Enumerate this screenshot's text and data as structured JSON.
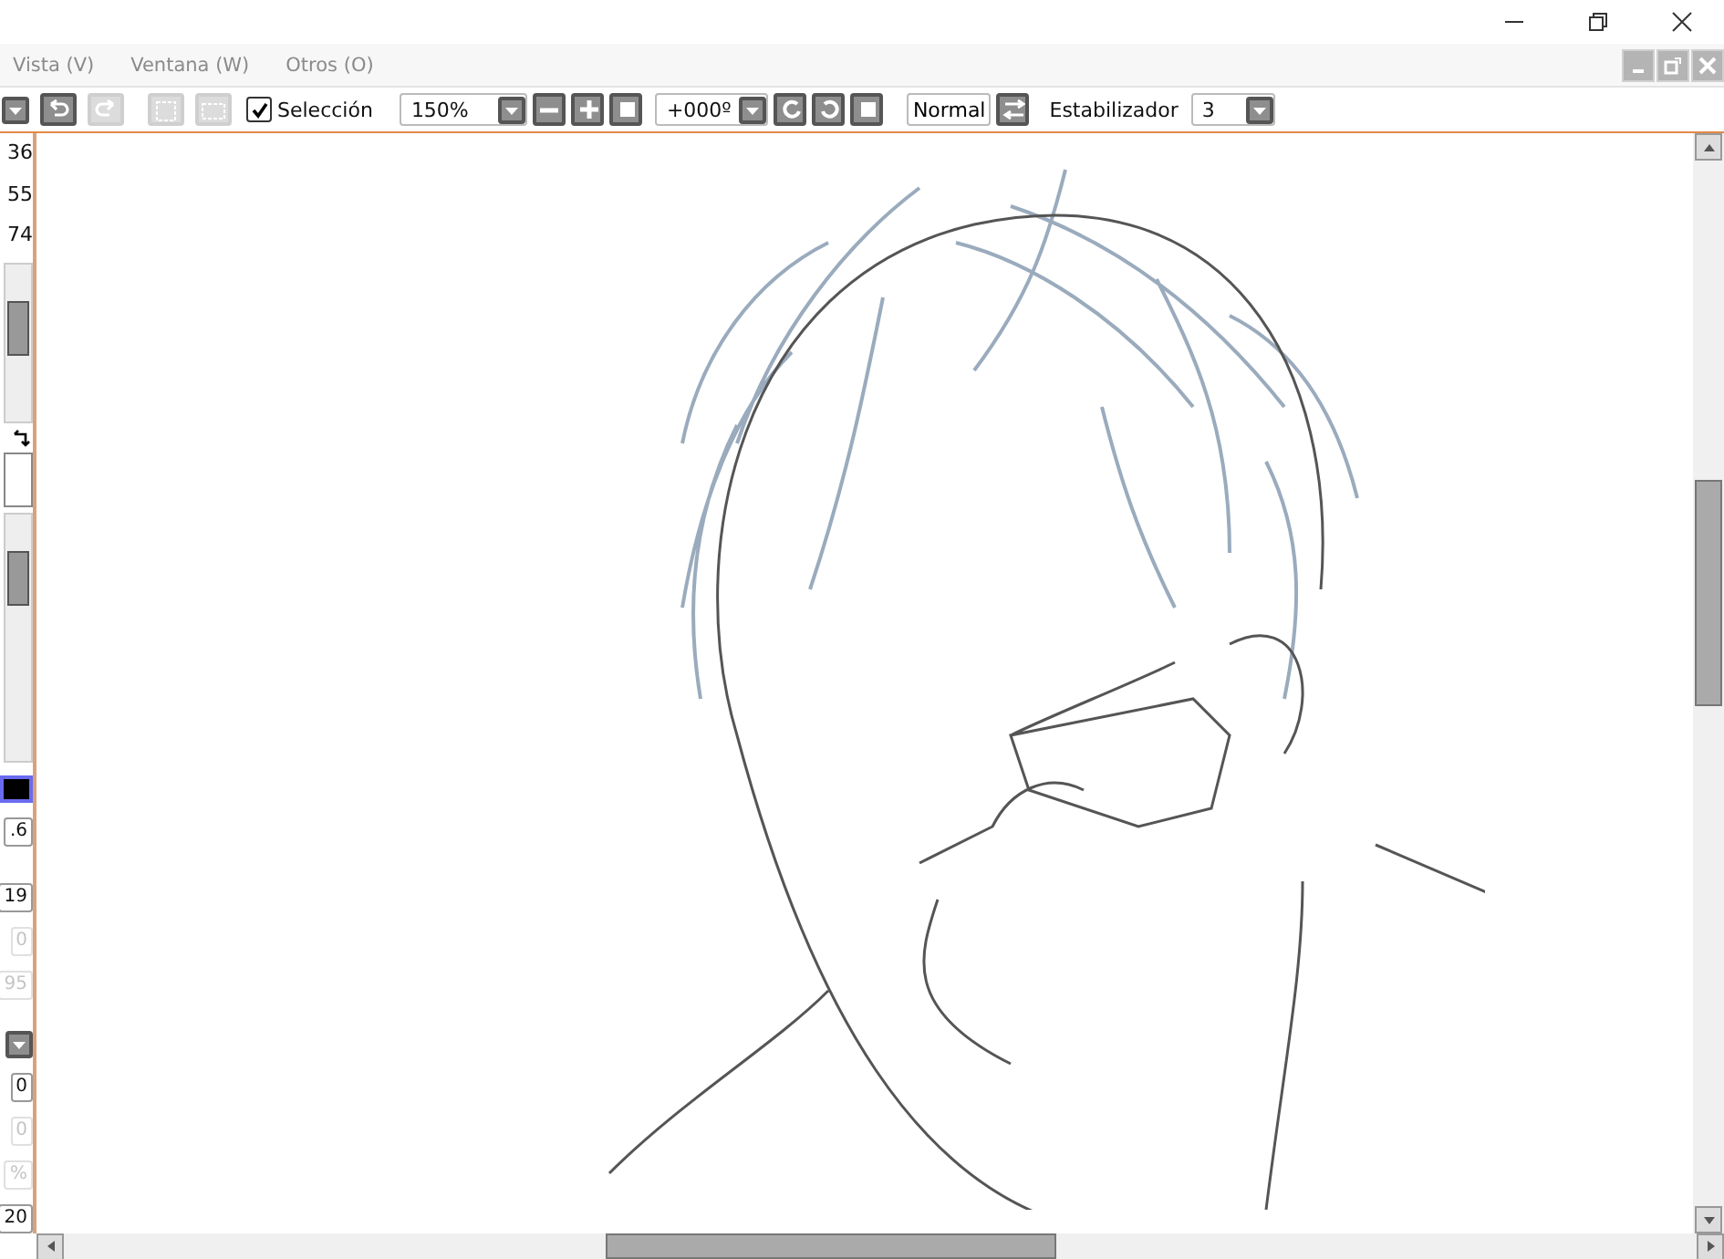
{
  "menu": [
    {
      "label": "Vista (V)"
    },
    {
      "label": "Ventana (W)"
    },
    {
      "label": "Otros (O)"
    }
  ],
  "toolbar": {
    "history_buttons": [
      {
        "kind": "undo",
        "disabled": false
      },
      {
        "kind": "redo",
        "disabled": true
      },
      {
        "kind": "deselect",
        "disabled": true
      },
      {
        "kind": "select-all",
        "disabled": true
      }
    ],
    "selection": {
      "label": "Selección",
      "checked": true
    },
    "zoom": "150%",
    "angle": "+000º",
    "blend_mode": "Normal",
    "stabilizer": {
      "label": "Estabilizador",
      "value": "3"
    }
  },
  "side_panel": {
    "top_values": [
      {
        "text": "36",
        "disabled": false
      },
      {
        "text": "55",
        "disabled": false
      },
      {
        "text": "74",
        "disabled": false
      }
    ],
    "lower_values": [
      {
        "text": ".6",
        "disabled": false
      },
      {
        "text": "19",
        "disabled": false
      },
      {
        "text": "0",
        "disabled": true
      },
      {
        "text": "95",
        "disabled": true
      }
    ],
    "bottom_values": [
      {
        "text": "0",
        "disabled": false
      },
      {
        "text": "0",
        "disabled": true
      },
      {
        "text": "%",
        "disabled": true
      },
      {
        "text": "20",
        "disabled": false
      }
    ]
  }
}
